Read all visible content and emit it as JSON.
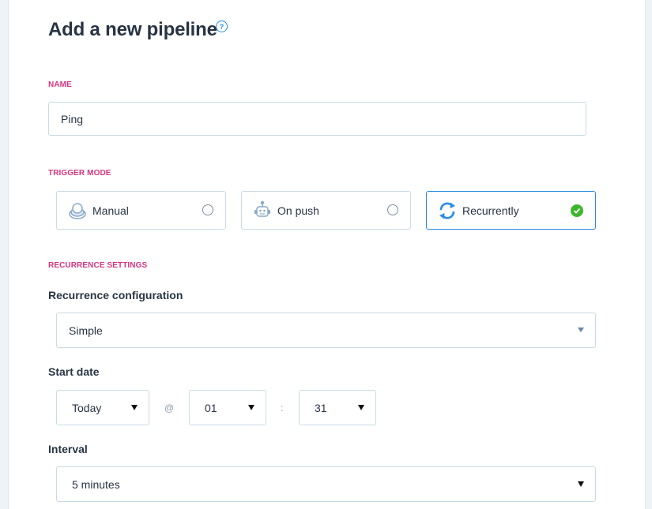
{
  "header": {
    "title": "Add a new pipeline",
    "help_icon": "question-circle-icon",
    "help_glyph": "?"
  },
  "name": {
    "section_label": "NAME",
    "value": "Ping"
  },
  "trigger_mode": {
    "section_label": "TRIGGER MODE",
    "options": [
      {
        "label": "Manual",
        "icon": "hand-button-icon",
        "selected": false
      },
      {
        "label": "On push",
        "icon": "robot-icon",
        "selected": false
      },
      {
        "label": "Recurrently",
        "icon": "recurring-arrows-icon",
        "selected": true
      }
    ]
  },
  "recurrence": {
    "section_label": "RECURRENCE SETTINGS",
    "configuration": {
      "label": "Recurrence configuration",
      "value": "Simple"
    },
    "start_date": {
      "label": "Start date",
      "day": "Today",
      "at_symbol": "@",
      "hour": "01",
      "colon": ":",
      "minute": "31"
    },
    "interval": {
      "label": "Interval",
      "value": "5 minutes"
    }
  },
  "colors": {
    "accent": "#2a8de3",
    "section_label": "#d9347f",
    "success": "#3fb52f",
    "border": "#c9dbe6"
  }
}
